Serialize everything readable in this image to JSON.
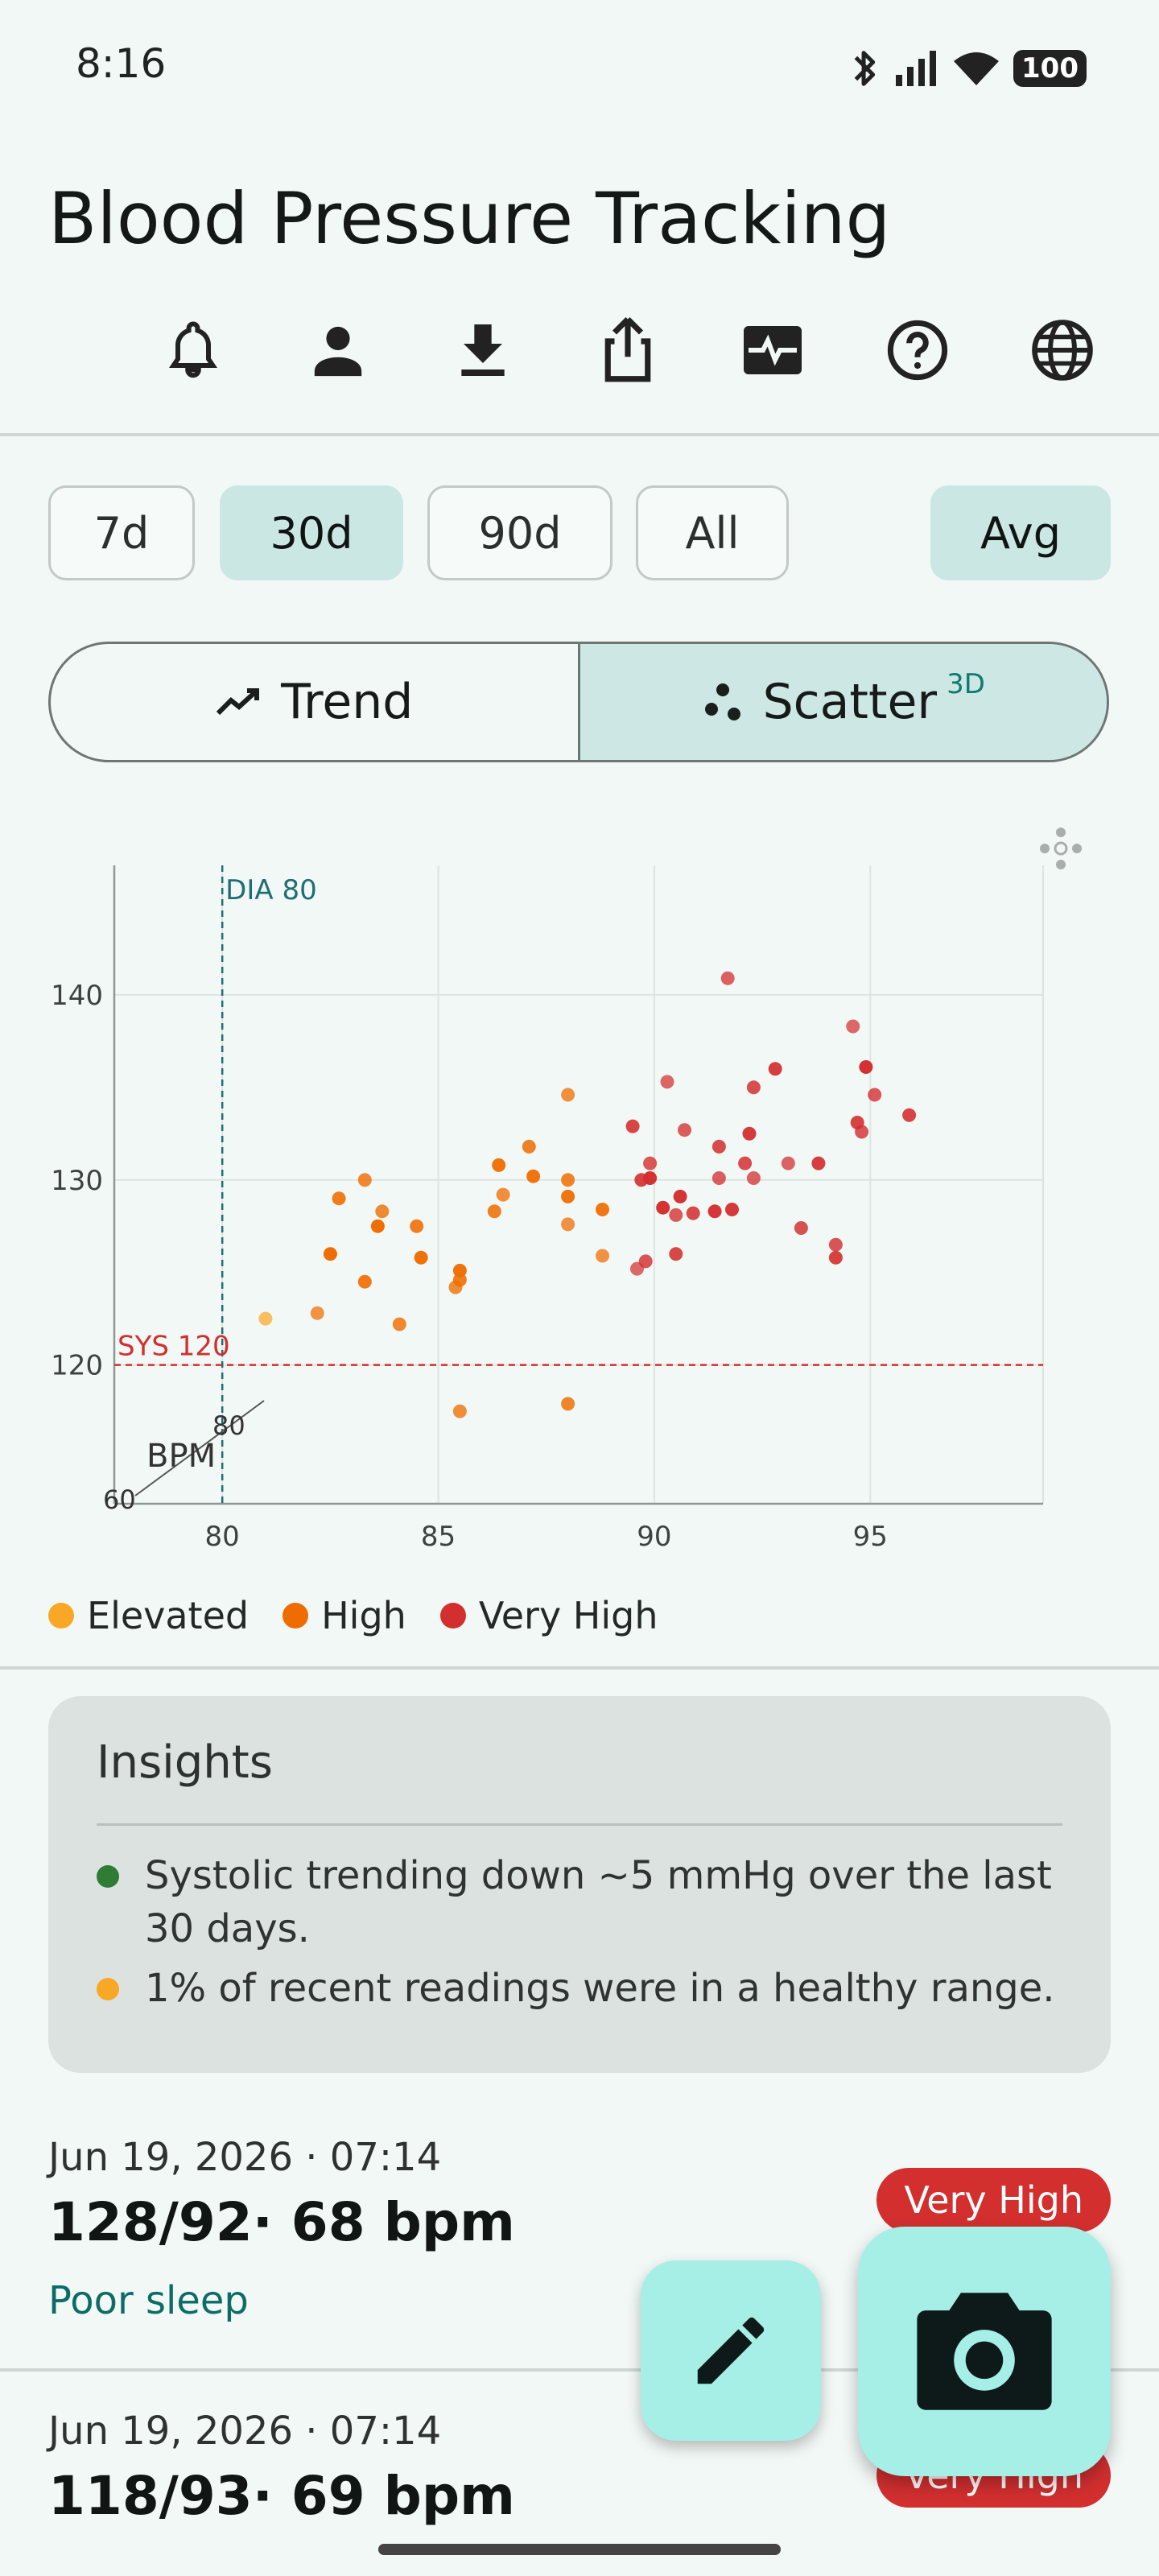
{
  "status_bar": {
    "time": "8:16",
    "battery": "100"
  },
  "header": {
    "title": "Blood Pressure Tracking"
  },
  "toolbar": {
    "icons": [
      "bell-icon",
      "person-icon",
      "download-icon",
      "share-icon",
      "vitals-icon",
      "help-icon",
      "globe-icon"
    ]
  },
  "range_chips": [
    {
      "label": "7d",
      "selected": false
    },
    {
      "label": "30d",
      "selected": true
    },
    {
      "label": "90d",
      "selected": false
    },
    {
      "label": "All",
      "selected": false
    }
  ],
  "avg_chip": {
    "label": "Avg",
    "selected": true
  },
  "view_toggle": {
    "trend_label": "Trend",
    "scatter_label": "Scatter",
    "scatter_badge": "3D",
    "selected": "scatter"
  },
  "chart_data": {
    "type": "scatter",
    "x_ticks": [
      "80",
      "85",
      "90",
      "95"
    ],
    "y_ticks": [
      "120",
      "130",
      "140"
    ],
    "xlim": [
      77.5,
      99
    ],
    "ylim": [
      112.5,
      147
    ],
    "z_axis": {
      "label": "BPM",
      "ticks": [
        "60",
        "80"
      ]
    },
    "reference_lines": [
      {
        "axis": "x",
        "value": 80,
        "label": "DIA 80",
        "color": "#1f6e74"
      },
      {
        "axis": "y",
        "value": 120,
        "label": "SYS 120",
        "color": "#d32f2f"
      }
    ],
    "series": [
      {
        "name": "Elevated",
        "color": "#f9a825",
        "points": [
          [
            81,
            122.5
          ]
        ]
      },
      {
        "name": "High",
        "color": "#ef6c00",
        "points": [
          [
            82.2,
            122.8
          ],
          [
            84.1,
            122.2
          ],
          [
            83.3,
            124.5
          ],
          [
            82.5,
            126
          ],
          [
            83.3,
            130
          ],
          [
            82.7,
            129
          ],
          [
            83.6,
            127.5
          ],
          [
            83.7,
            128.3
          ],
          [
            84.5,
            127.5
          ],
          [
            84.6,
            125.8
          ],
          [
            85.4,
            124.2
          ],
          [
            85.5,
            124.6
          ],
          [
            85.5,
            125.1
          ],
          [
            85.5,
            117.5
          ],
          [
            86.3,
            128.3
          ],
          [
            86.4,
            130.8
          ],
          [
            86.5,
            129.2
          ],
          [
            87.1,
            131.8
          ],
          [
            87.2,
            130.2
          ],
          [
            88,
            134.6
          ],
          [
            88,
            130
          ],
          [
            88,
            129.1
          ],
          [
            88,
            127.6
          ],
          [
            88,
            117.9
          ],
          [
            88.8,
            128.4
          ],
          [
            88.8,
            125.9
          ]
        ]
      },
      {
        "name": "Very High",
        "color": "#d32f2f",
        "points": [
          [
            89.6,
            125.2
          ],
          [
            89.8,
            125.6
          ],
          [
            89.7,
            130
          ],
          [
            89.9,
            130.1
          ],
          [
            89.9,
            130.9
          ],
          [
            89.5,
            132.9
          ],
          [
            90.2,
            128.5
          ],
          [
            90.5,
            128.1
          ],
          [
            90.5,
            126
          ],
          [
            90.6,
            129.1
          ],
          [
            90.7,
            132.7
          ],
          [
            90.9,
            128.2
          ],
          [
            91.4,
            128.3
          ],
          [
            91.5,
            130.1
          ],
          [
            91.5,
            131.8
          ],
          [
            91.8,
            128.4
          ],
          [
            91.7,
            140.9
          ],
          [
            92.1,
            130.9
          ],
          [
            92.2,
            132.5
          ],
          [
            92.3,
            130.1
          ],
          [
            92.3,
            135
          ],
          [
            92.8,
            136
          ],
          [
            93.1,
            130.9
          ],
          [
            93.4,
            127.4
          ],
          [
            93.8,
            130.9
          ],
          [
            90.3,
            135.3
          ],
          [
            94.2,
            126.5
          ],
          [
            94.2,
            125.8
          ],
          [
            94.6,
            138.3
          ],
          [
            94.8,
            132.6
          ],
          [
            94.7,
            133.1
          ],
          [
            94.9,
            136.1
          ],
          [
            95.1,
            134.6
          ],
          [
            95.9,
            133.5
          ]
        ]
      }
    ]
  },
  "legend": [
    {
      "label": "Elevated",
      "color": "#f9a825"
    },
    {
      "label": "High",
      "color": "#ef6c00"
    },
    {
      "label": "Very High",
      "color": "#d32f2f"
    }
  ],
  "insights": {
    "title": "Insights",
    "items": [
      {
        "text": "Systolic trending down ~5 mmHg over the last 30 days.",
        "color": "#2e7d32"
      },
      {
        "text": "1% of recent readings were in a healthy range.",
        "color": "#f9a825"
      }
    ]
  },
  "entries": [
    {
      "date": "Jun 19, 2026 · 07:14",
      "value": "128/92· 68 bpm",
      "note": "Poor sleep",
      "badge": "Very High"
    },
    {
      "date": "Jun 19, 2026 · 07:14",
      "value": "118/93· 69 bpm",
      "badge": "Very High"
    }
  ]
}
